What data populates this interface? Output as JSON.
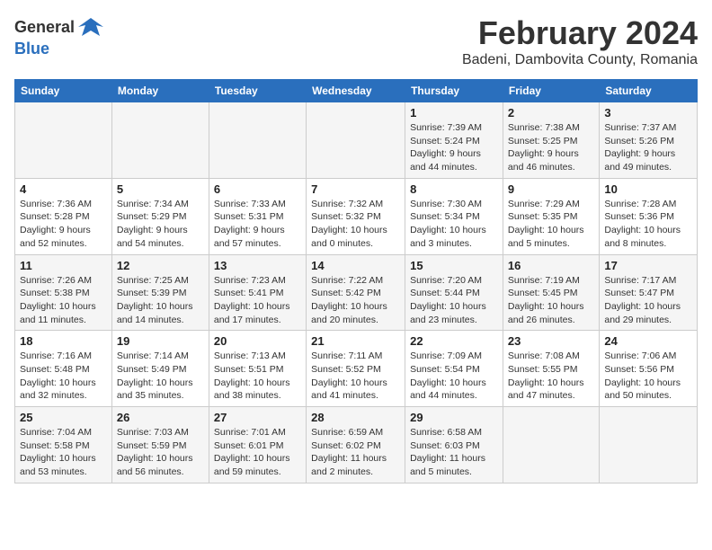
{
  "logo": {
    "general": "General",
    "blue": "Blue"
  },
  "title": "February 2024",
  "subtitle": "Badeni, Dambovita County, Romania",
  "days_of_week": [
    "Sunday",
    "Monday",
    "Tuesday",
    "Wednesday",
    "Thursday",
    "Friday",
    "Saturday"
  ],
  "weeks": [
    [
      {
        "day": "",
        "info": ""
      },
      {
        "day": "",
        "info": ""
      },
      {
        "day": "",
        "info": ""
      },
      {
        "day": "",
        "info": ""
      },
      {
        "day": "1",
        "info": "Sunrise: 7:39 AM\nSunset: 5:24 PM\nDaylight: 9 hours and 44 minutes."
      },
      {
        "day": "2",
        "info": "Sunrise: 7:38 AM\nSunset: 5:25 PM\nDaylight: 9 hours and 46 minutes."
      },
      {
        "day": "3",
        "info": "Sunrise: 7:37 AM\nSunset: 5:26 PM\nDaylight: 9 hours and 49 minutes."
      }
    ],
    [
      {
        "day": "4",
        "info": "Sunrise: 7:36 AM\nSunset: 5:28 PM\nDaylight: 9 hours and 52 minutes."
      },
      {
        "day": "5",
        "info": "Sunrise: 7:34 AM\nSunset: 5:29 PM\nDaylight: 9 hours and 54 minutes."
      },
      {
        "day": "6",
        "info": "Sunrise: 7:33 AM\nSunset: 5:31 PM\nDaylight: 9 hours and 57 minutes."
      },
      {
        "day": "7",
        "info": "Sunrise: 7:32 AM\nSunset: 5:32 PM\nDaylight: 10 hours and 0 minutes."
      },
      {
        "day": "8",
        "info": "Sunrise: 7:30 AM\nSunset: 5:34 PM\nDaylight: 10 hours and 3 minutes."
      },
      {
        "day": "9",
        "info": "Sunrise: 7:29 AM\nSunset: 5:35 PM\nDaylight: 10 hours and 5 minutes."
      },
      {
        "day": "10",
        "info": "Sunrise: 7:28 AM\nSunset: 5:36 PM\nDaylight: 10 hours and 8 minutes."
      }
    ],
    [
      {
        "day": "11",
        "info": "Sunrise: 7:26 AM\nSunset: 5:38 PM\nDaylight: 10 hours and 11 minutes."
      },
      {
        "day": "12",
        "info": "Sunrise: 7:25 AM\nSunset: 5:39 PM\nDaylight: 10 hours and 14 minutes."
      },
      {
        "day": "13",
        "info": "Sunrise: 7:23 AM\nSunset: 5:41 PM\nDaylight: 10 hours and 17 minutes."
      },
      {
        "day": "14",
        "info": "Sunrise: 7:22 AM\nSunset: 5:42 PM\nDaylight: 10 hours and 20 minutes."
      },
      {
        "day": "15",
        "info": "Sunrise: 7:20 AM\nSunset: 5:44 PM\nDaylight: 10 hours and 23 minutes."
      },
      {
        "day": "16",
        "info": "Sunrise: 7:19 AM\nSunset: 5:45 PM\nDaylight: 10 hours and 26 minutes."
      },
      {
        "day": "17",
        "info": "Sunrise: 7:17 AM\nSunset: 5:47 PM\nDaylight: 10 hours and 29 minutes."
      }
    ],
    [
      {
        "day": "18",
        "info": "Sunrise: 7:16 AM\nSunset: 5:48 PM\nDaylight: 10 hours and 32 minutes."
      },
      {
        "day": "19",
        "info": "Sunrise: 7:14 AM\nSunset: 5:49 PM\nDaylight: 10 hours and 35 minutes."
      },
      {
        "day": "20",
        "info": "Sunrise: 7:13 AM\nSunset: 5:51 PM\nDaylight: 10 hours and 38 minutes."
      },
      {
        "day": "21",
        "info": "Sunrise: 7:11 AM\nSunset: 5:52 PM\nDaylight: 10 hours and 41 minutes."
      },
      {
        "day": "22",
        "info": "Sunrise: 7:09 AM\nSunset: 5:54 PM\nDaylight: 10 hours and 44 minutes."
      },
      {
        "day": "23",
        "info": "Sunrise: 7:08 AM\nSunset: 5:55 PM\nDaylight: 10 hours and 47 minutes."
      },
      {
        "day": "24",
        "info": "Sunrise: 7:06 AM\nSunset: 5:56 PM\nDaylight: 10 hours and 50 minutes."
      }
    ],
    [
      {
        "day": "25",
        "info": "Sunrise: 7:04 AM\nSunset: 5:58 PM\nDaylight: 10 hours and 53 minutes."
      },
      {
        "day": "26",
        "info": "Sunrise: 7:03 AM\nSunset: 5:59 PM\nDaylight: 10 hours and 56 minutes."
      },
      {
        "day": "27",
        "info": "Sunrise: 7:01 AM\nSunset: 6:01 PM\nDaylight: 10 hours and 59 minutes."
      },
      {
        "day": "28",
        "info": "Sunrise: 6:59 AM\nSunset: 6:02 PM\nDaylight: 11 hours and 2 minutes."
      },
      {
        "day": "29",
        "info": "Sunrise: 6:58 AM\nSunset: 6:03 PM\nDaylight: 11 hours and 5 minutes."
      },
      {
        "day": "",
        "info": ""
      },
      {
        "day": "",
        "info": ""
      }
    ]
  ]
}
